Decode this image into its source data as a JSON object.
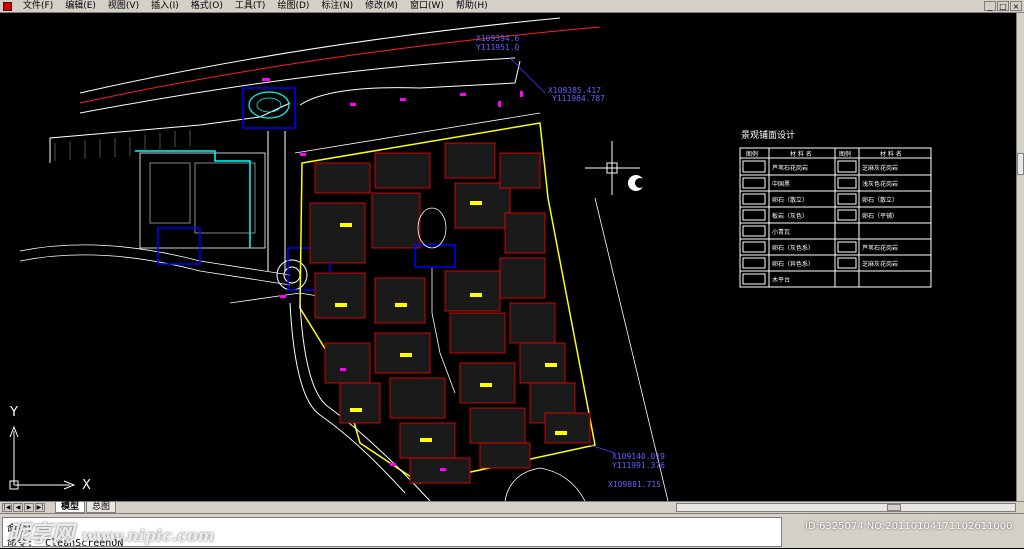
{
  "menu": {
    "items": [
      "文件(F)",
      "编辑(E)",
      "视图(V)",
      "插入(I)",
      "格式(O)",
      "工具(T)",
      "绘图(D)",
      "标注(N)",
      "修改(M)",
      "窗口(W)",
      "帮助(H)"
    ],
    "window_controls": [
      "_",
      "□",
      "×"
    ]
  },
  "drawing": {
    "coords": {
      "c1_x": "X109394.6",
      "c1_y": "Y111951.0",
      "c2_x": "X109385.417",
      "c2_y": "Y111964.787",
      "c3_x": "X109140.019",
      "c3_y": "Y111991.376",
      "c4": "X109881.715"
    },
    "ucs": {
      "x": "X",
      "y": "Y"
    },
    "colors": {
      "background": "#000000",
      "road": "#ffffff",
      "boundary": "#ffff00",
      "building": "#ff0000",
      "highlight": "#0000ff",
      "water": "#00ffff"
    }
  },
  "legend": {
    "title": "景观铺面设计",
    "headers": [
      "图例",
      "材 料 名",
      "图例",
      "材 料 名"
    ],
    "rows": [
      [
        "芦苇石花岗岩",
        "芝麻灰花岗岩"
      ],
      [
        "中国黑",
        "浅灰色花岗岩"
      ],
      [
        "卵石（散立）",
        "卵石（散立）"
      ],
      [
        "板岩（灰色）",
        "卵石（平铺）"
      ],
      [
        "小青瓦",
        ""
      ],
      [
        "卵石（灰色系）",
        "芦苇石花岗岩"
      ],
      [
        "卵石（异色系）",
        "芝麻灰花岗岩"
      ],
      [
        "木平台",
        ""
      ]
    ]
  },
  "tabs": {
    "nav": [
      "|◀",
      "◀",
      "▶",
      "▶|"
    ],
    "model": "模型",
    "layout": "总图"
  },
  "command": {
    "line1": "命令：",
    "line2": "命令: _CleanScreenON"
  },
  "watermark": {
    "text": "昵享网",
    "url": "www.nipic.com",
    "id": "ID:6325074 NO:20110104171102611000"
  }
}
